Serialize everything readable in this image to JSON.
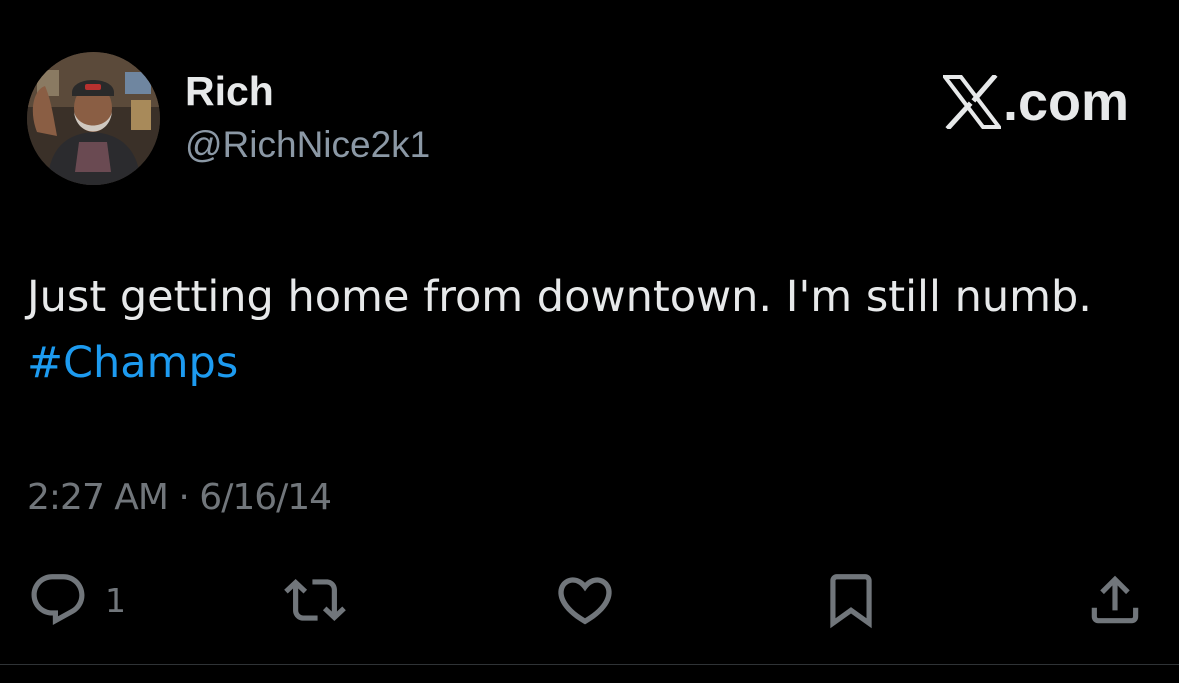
{
  "author": {
    "name": "Rich",
    "handle": "@RichNice2k1",
    "avatar_icon": "profile-photo"
  },
  "brand": {
    "label": ".com",
    "logo_icon": "x-logo-icon"
  },
  "tweet": {
    "text_line1": "Just getting home from downtown. I'm still numb.",
    "hashtag": "#Champs",
    "timestamp": "2:27 AM · 6/16/14"
  },
  "actions": {
    "reply": {
      "icon": "reply-icon",
      "count": "1"
    },
    "retweet": {
      "icon": "retweet-icon"
    },
    "like": {
      "icon": "heart-icon"
    },
    "bookmark": {
      "icon": "bookmark-icon"
    },
    "share": {
      "icon": "share-icon"
    }
  },
  "colors": {
    "background": "#000000",
    "primary_text": "#e7e9ea",
    "secondary_text": "#71767b",
    "link": "#1d9bf0"
  }
}
